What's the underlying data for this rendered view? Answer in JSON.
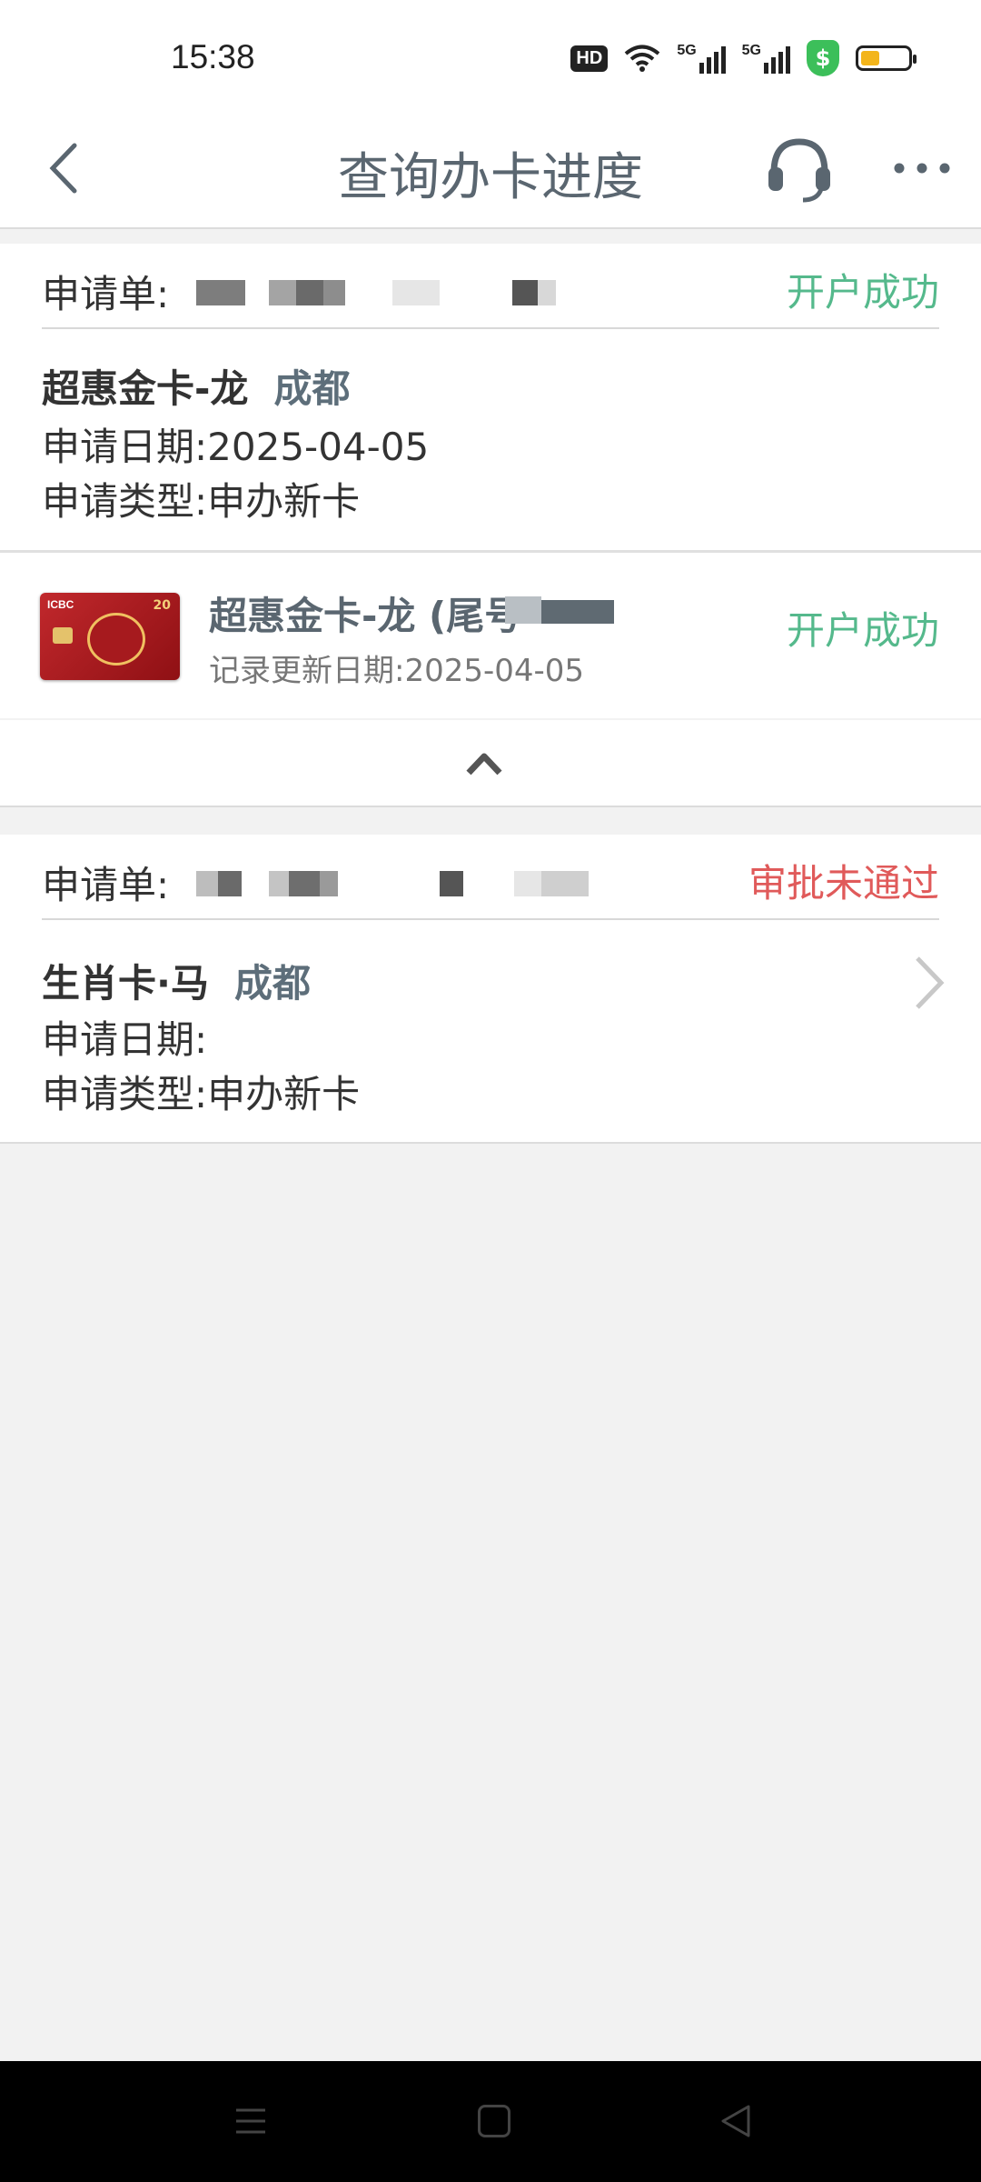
{
  "status_bar": {
    "time": "15:38",
    "network_tag": "5G",
    "battery_level": 0.4
  },
  "nav": {
    "title": "查询办卡进度"
  },
  "applications": [
    {
      "label": "申请单:",
      "status": "开户成功",
      "card_name": "超惠金卡-龙",
      "city": "成都",
      "date_line": "申请日期:2025-04-05",
      "type_line": "申请类型:申办新卡",
      "card_row": {
        "name": "超惠金卡-龙 (尾号",
        "update_line": "记录更新日期:2025-04-05",
        "status": "开户成功",
        "image_logo": "ICBC",
        "image_number": "20"
      }
    },
    {
      "label": "申请单:",
      "status": "审批未通过",
      "card_name": "生肖卡·马",
      "city": "成都",
      "date_line": "申请日期:",
      "type_line": "申请类型:申办新卡"
    }
  ],
  "colors": {
    "success": "#55b98c",
    "failure": "#e05a5a",
    "title": "#5a6670"
  },
  "icons": [
    "back-arrow-icon",
    "headset-icon",
    "more-dots-icon",
    "chevron-up-icon",
    "chevron-right-icon",
    "menu-icon",
    "home-icon",
    "back-triangle-icon"
  ]
}
